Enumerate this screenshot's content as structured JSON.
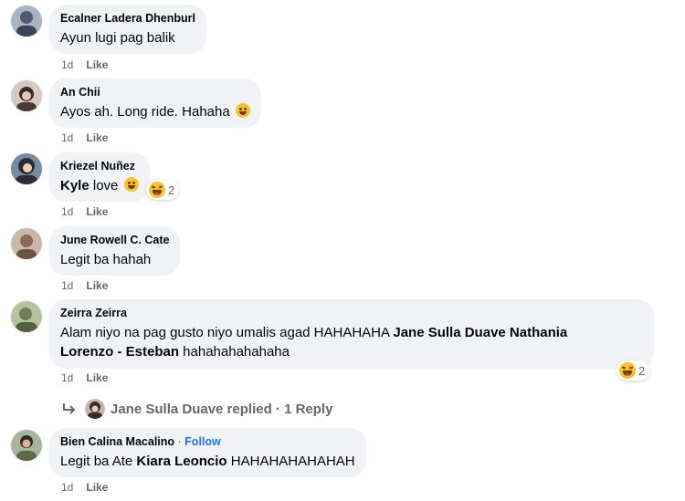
{
  "comments": [
    {
      "name": "Ecalner Ladera Dhenburl",
      "text": "Ayun lugi pag balik",
      "time": "1d",
      "like": "Like",
      "avatar_color": "#4f5b70"
    },
    {
      "name": "An Chii",
      "text": "Ayos ah. Long ride. Hahaha",
      "time": "1d",
      "like": "Like",
      "avatar_color": "#3d2b2b"
    },
    {
      "name": "Kriezel Nuñez",
      "mention": "Kyle",
      "text": " love",
      "time": "1d",
      "like": "Like",
      "reaction_count": "2",
      "avatar_color": "#2d2a38"
    },
    {
      "name": "June Rowell C. Cate",
      "text": "Legit ba hahah",
      "time": "1d",
      "like": "Like",
      "avatar_color": "#8a6a55"
    },
    {
      "name": "Zeirra Zeirra",
      "text_before": "Alam niyo na pag gusto niyo umalis agad HAHAHAHA ",
      "mention_line1": "Jane Sulla Duave Nathania",
      "mention_line2": "Lorenzo - Esteban",
      "text_after": " hahahahahahaha",
      "time": "1d",
      "like": "Like",
      "reaction_count": "2",
      "avatar_color": "#6f7f5a"
    },
    {
      "name": "Bien Calina Macalino",
      "follow": "Follow",
      "separator": "·",
      "text_before": "Legit ba Ate ",
      "mention": "Kiara Leoncio",
      "text_after": " HAHAHAHAHAHAH",
      "time": "1d",
      "like": "Like",
      "avatar_color": "#5a6b4a"
    }
  ],
  "replies": {
    "label": "Jane Sulla Duave replied · 1 Reply",
    "avatar_color": "#3a2c2c"
  },
  "colors": {
    "bubble": "#f0f2f5",
    "meta": "#65676b",
    "link": "#1877f2"
  }
}
